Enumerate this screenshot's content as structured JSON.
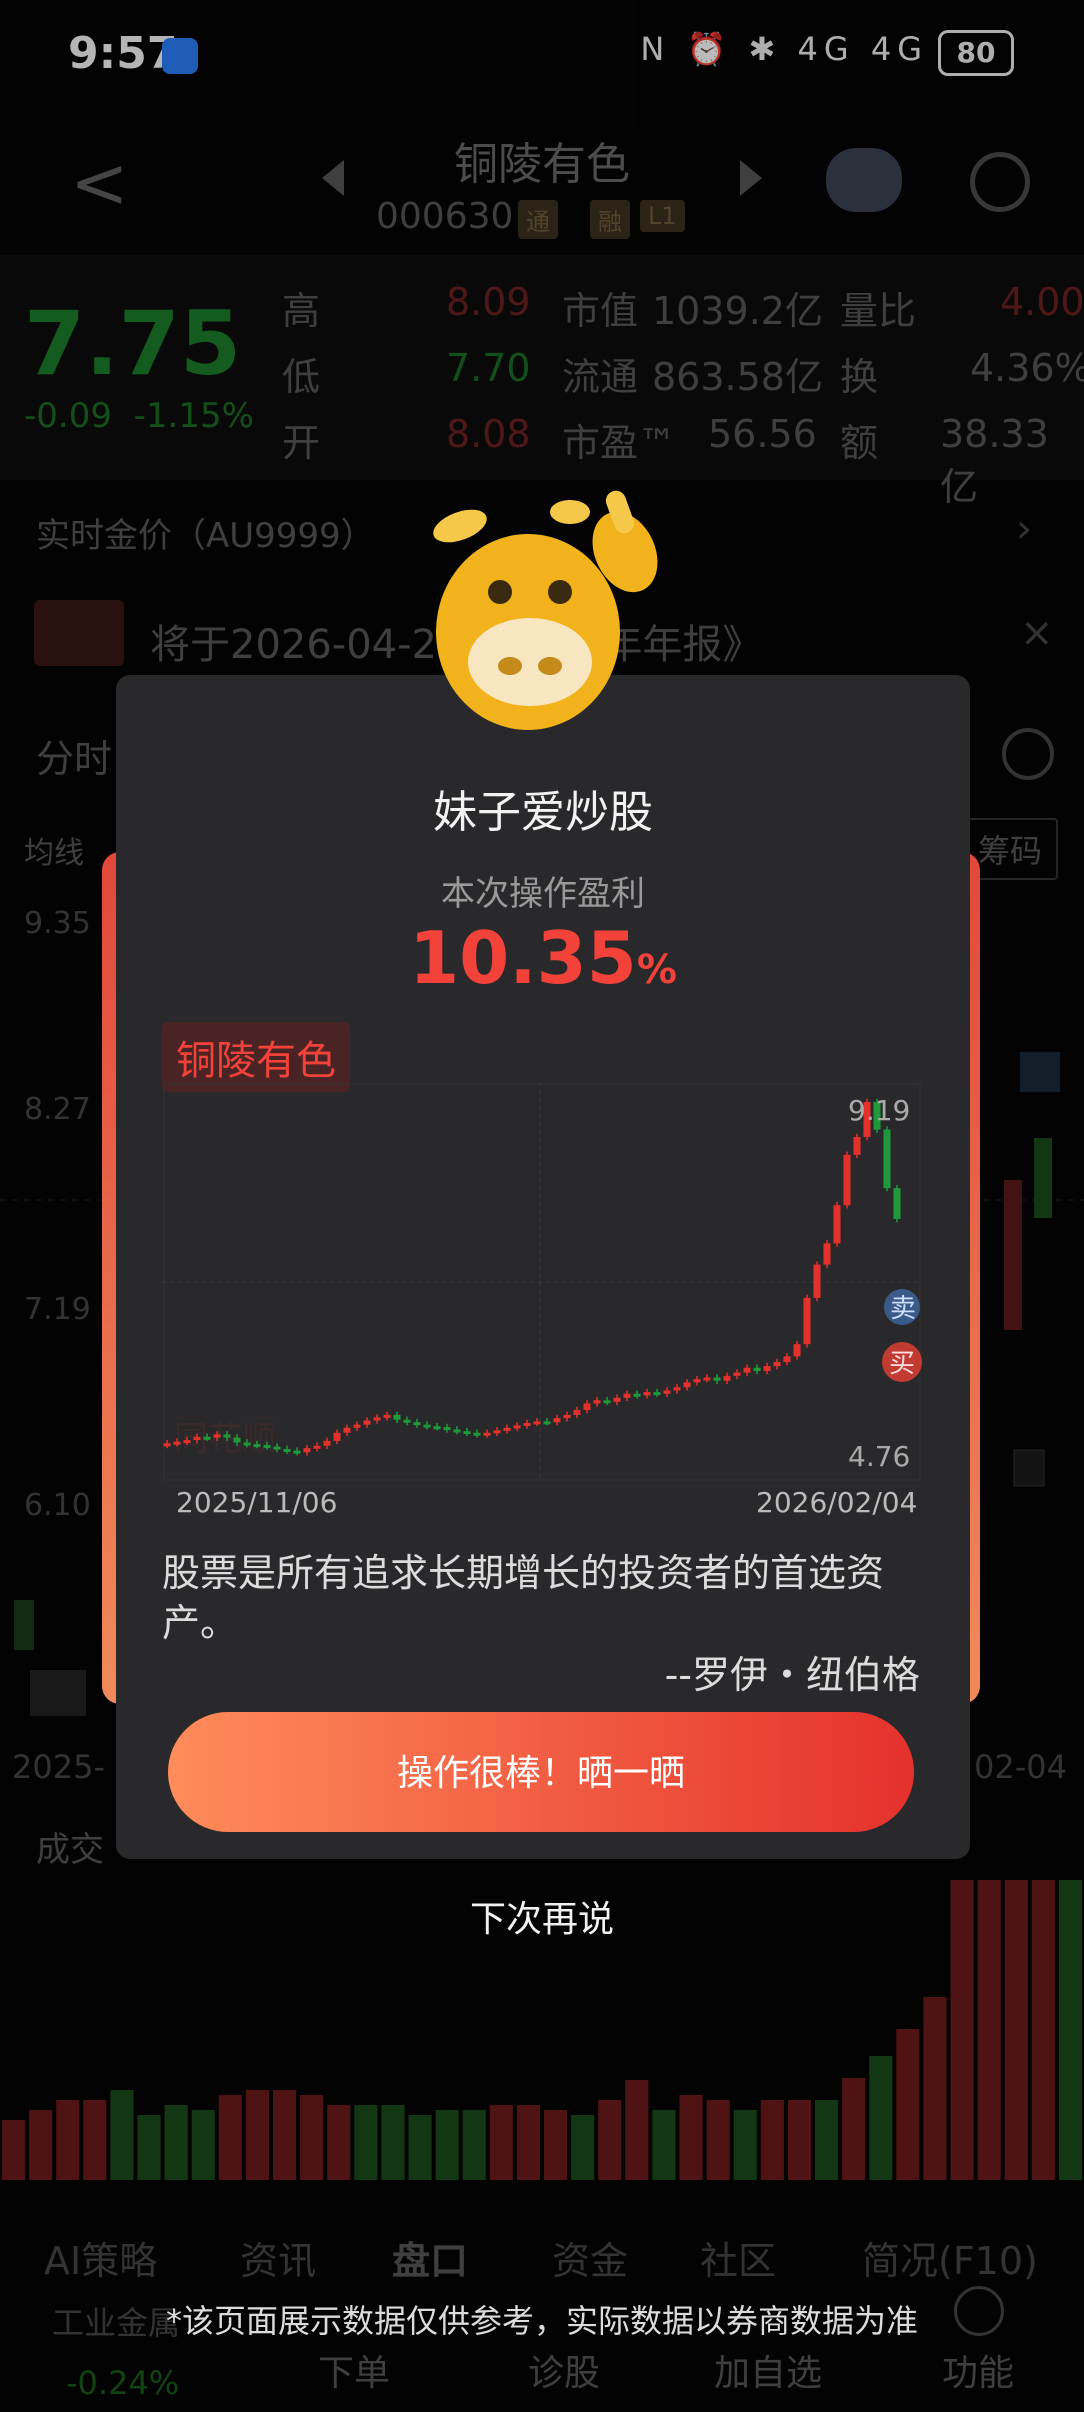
{
  "status_bar": {
    "time": "9:57",
    "battery": "80",
    "icons": "N ⏰ ✱ 4G 4G"
  },
  "header": {
    "title": "铜陵有色",
    "code": "000630",
    "tags": [
      "通",
      "融",
      "L1"
    ]
  },
  "quote": {
    "price": "7.75",
    "change": "-0.09",
    "change_pct": "-1.15%",
    "high_label": "高",
    "high": "8.09",
    "low_label": "低",
    "low": "7.70",
    "open_label": "开",
    "open": "8.08",
    "mcap_label": "市值",
    "mcap": "1039.2亿",
    "float_label": "流通",
    "float": "863.58亿",
    "pe_label": "市盈™",
    "pe": "56.56",
    "vr_label": "量比",
    "vr": "4.00",
    "turnover_label": "换",
    "turnover": "4.36%",
    "amount_label": "额",
    "amount": "38.33亿"
  },
  "gold_price": {
    "label": "实时金价（AU9999）"
  },
  "news": {
    "text": "将于2026-04-20...2025年年报》"
  },
  "chart_tabs": {
    "fenshi": "分时",
    "junxian": "均线",
    "chouma": "筹码"
  },
  "bg_axis": [
    "9.35",
    "8.27",
    "7.19",
    "6.10"
  ],
  "bg_dates": {
    "start": "2025-",
    "end": "02-04"
  },
  "volume_label": "成交",
  "bottom_tabs": [
    "AI策略",
    "资讯",
    "盘口",
    "资金",
    "社区",
    "简况(F10)"
  ],
  "bottom_nav": [
    "下单",
    "诊股",
    "加自选",
    "功能"
  ],
  "industry": {
    "label": "工业金属",
    "value": "-0.24%"
  },
  "modal": {
    "user": "妹子爱炒股",
    "subtitle": "本次操作盈利",
    "profit": "10.35",
    "profit_unit": "%",
    "stock": "铜陵有色",
    "chart_high": "9.19",
    "chart_low": "4.76",
    "date_start": "2025/11/06",
    "date_end": "2026/02/04",
    "sell_mark": "卖",
    "buy_mark": "买",
    "watermark": "同花顺",
    "quote": "股票是所有追求长期增长的投资者的首选资产。",
    "author": "--罗伊・纽伯格",
    "share_button": "操作很棒！晒一晒",
    "later": "下次再说"
  },
  "disclaimer": "*该页面展示数据仅供参考，实际数据以券商数据为准",
  "colors": {
    "up": "#e5312c",
    "down": "#1f9a3a",
    "accent": "#f2423a"
  },
  "chart_data": {
    "type": "candlestick",
    "title": "",
    "x_start": "2025/11/06",
    "x_end": "2026/02/04",
    "y_labels": {
      "max": 9.19,
      "min": 4.76
    },
    "closes": [
      4.99,
      5.01,
      5.03,
      5.07,
      5.06,
      5.1,
      5.06,
      5.0,
      4.98,
      4.97,
      4.95,
      4.92,
      4.9,
      4.88,
      4.93,
      4.96,
      5.02,
      5.12,
      5.18,
      5.22,
      5.27,
      5.31,
      5.34,
      5.28,
      5.25,
      5.22,
      5.2,
      5.19,
      5.16,
      5.14,
      5.12,
      5.1,
      5.12,
      5.15,
      5.18,
      5.21,
      5.24,
      5.26,
      5.25,
      5.3,
      5.34,
      5.4,
      5.48,
      5.52,
      5.5,
      5.55,
      5.6,
      5.58,
      5.62,
      5.6,
      5.64,
      5.68,
      5.74,
      5.78,
      5.8,
      5.76,
      5.82,
      5.86,
      5.92,
      5.88,
      5.94,
      5.99,
      6.06,
      6.21,
      6.78,
      7.19,
      7.45,
      7.92,
      8.54,
      8.76,
      9.19,
      8.85,
      8.13,
      7.75
    ]
  }
}
